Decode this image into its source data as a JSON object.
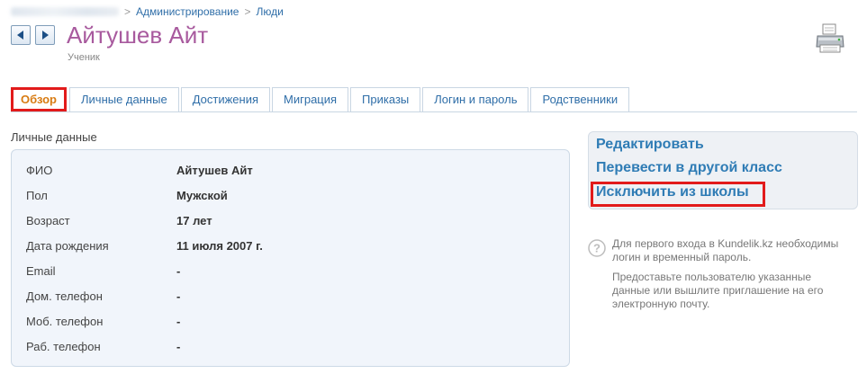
{
  "breadcrumb": {
    "items": [
      "Администрирование",
      "Люди"
    ],
    "separator": ">"
  },
  "header": {
    "title": "Айтушев Айт",
    "subtitle": "Ученик"
  },
  "tabs": [
    {
      "label": "Обзор",
      "active": true
    },
    {
      "label": "Личные данные",
      "active": false
    },
    {
      "label": "Достижения",
      "active": false
    },
    {
      "label": "Миграция",
      "active": false
    },
    {
      "label": "Приказы",
      "active": false
    },
    {
      "label": "Логин и пароль",
      "active": false
    },
    {
      "label": "Родственники",
      "active": false
    }
  ],
  "personal": {
    "section_title": "Личные данные",
    "rows": [
      {
        "label": "ФИО",
        "value": "Айтушев Айт"
      },
      {
        "label": "Пол",
        "value": "Мужской"
      },
      {
        "label": "Возраст",
        "value": "17 лет"
      },
      {
        "label": "Дата рождения",
        "value": "11 июля 2007 г."
      },
      {
        "label": "Email",
        "value": "-"
      },
      {
        "label": "Дом. телефон",
        "value": "-"
      },
      {
        "label": "Моб. телефон",
        "value": "-"
      },
      {
        "label": "Раб. телефон",
        "value": "-"
      }
    ]
  },
  "actions": {
    "edit": "Редактировать",
    "transfer": "Перевести в другой класс",
    "expel": "Исключить из школы"
  },
  "help": {
    "line1": "Для первого входа в Kundelik.kz необходимы логин и временный пароль.",
    "line2": "Предоставьте пользователю указанные данные или вышлите приглашение на его электронную почту."
  },
  "colors": {
    "title": "#a85a9e",
    "link": "#2f6ea8",
    "active_tab": "#d87b12",
    "highlight": "#e21b1b"
  }
}
